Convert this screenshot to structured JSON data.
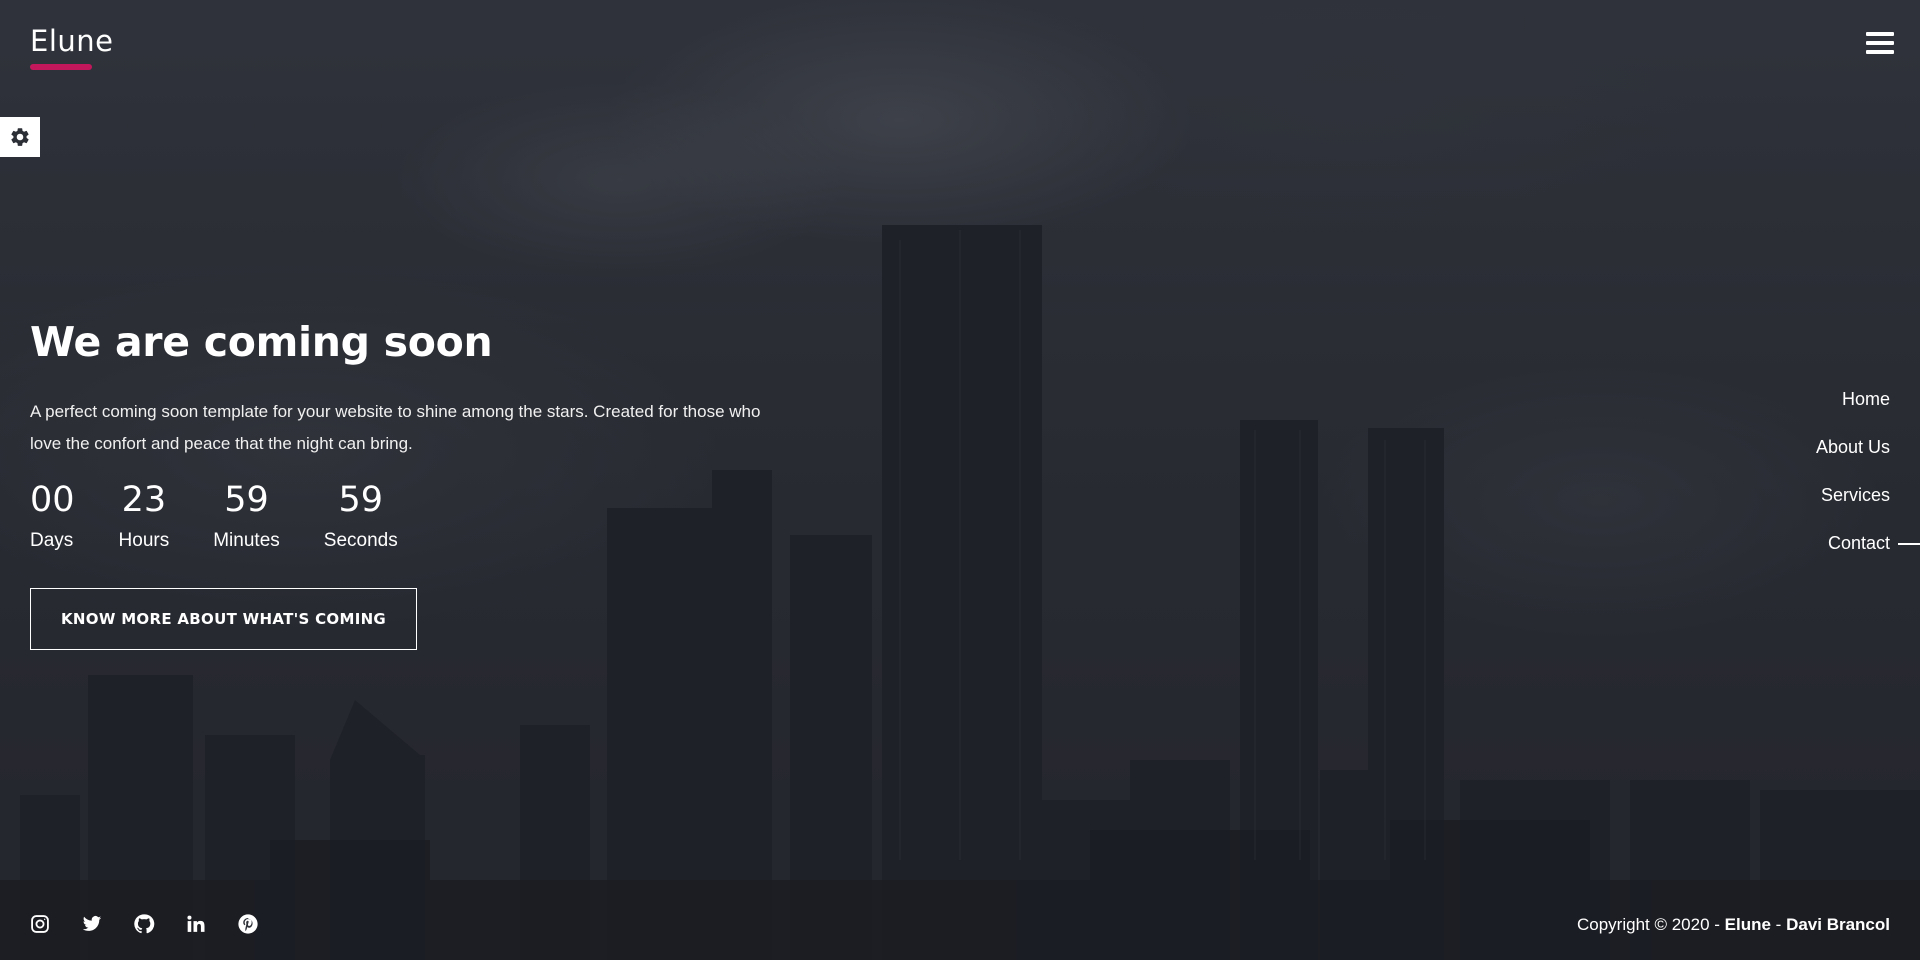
{
  "brand": {
    "name": "Elune",
    "accent_color": "#c2185b"
  },
  "header": {
    "menu_icon": "hamburger-menu-icon"
  },
  "settings": {
    "icon": "gear-icon"
  },
  "hero": {
    "title": "We are coming soon",
    "description": "A perfect coming soon template for your website to shine among the stars. Created for those who love the confort and peace that the night can bring.",
    "countdown": [
      {
        "value": "00",
        "label": "Days"
      },
      {
        "value": "23",
        "label": "Hours"
      },
      {
        "value": "59",
        "label": "Minutes"
      },
      {
        "value": "59",
        "label": "Seconds"
      }
    ],
    "cta_label": "KNOW MORE ABOUT WHAT'S COMING"
  },
  "nav": {
    "items": [
      {
        "label": "Home"
      },
      {
        "label": "About Us"
      },
      {
        "label": "Services"
      },
      {
        "label": "Contact",
        "active": true
      }
    ]
  },
  "footer": {
    "social": [
      "instagram-icon",
      "twitter-icon",
      "github-icon",
      "linkedin-icon",
      "pinterest-icon"
    ],
    "copyright_prefix": "Copyright © 2020 - ",
    "copyright_brand": "Elune",
    "copyright_sep": " - ",
    "copyright_author": "Davi Brancol"
  }
}
